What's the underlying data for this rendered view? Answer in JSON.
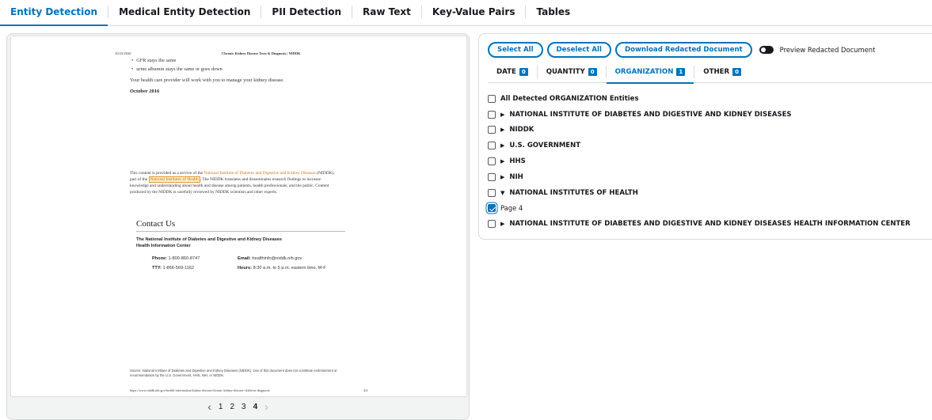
{
  "top_tabs": [
    {
      "label": "Entity Detection"
    },
    {
      "label": "Medical Entity Detection"
    },
    {
      "label": "PII Detection"
    },
    {
      "label": "Raw Text"
    },
    {
      "label": "Key-Value Pairs"
    },
    {
      "label": "Tables"
    }
  ],
  "document": {
    "header_date": "10/23/2020",
    "header_title": "Chronic Kidney Disease Tests & Diagnosis | NIDDK",
    "bullets": [
      "GFR stays the same",
      "urine albumin stays the same or goes down"
    ],
    "manage_line": "Your health care provider will work with you to manage your kidney disease.",
    "date_heading": "October 2016",
    "para1_a": "This content is provided as a service of the ",
    "para1_link": "National Institute of Diabetes and Digestive and Kidney Diseases",
    "para1_b": " (NIDDK),",
    "para2_a": "part of the ",
    "para2_highlight": "National Institutes of Health",
    "para2_b": ". The NIDDK translates and disseminates research findings to increase",
    "para3": "knowledge and understanding about health and disease among patients, health professionals, and the public. Content",
    "para4": "produced by the NIDDK is carefully reviewed by NIDDK scientists and other experts.",
    "contact_title": "Contact Us",
    "contact_org_1": "The National Institute of Diabetes and Digestive and Kidney Diseases",
    "contact_org_2": "Health Information Center",
    "phone_label": "Phone:",
    "phone_value": "1-800-860-8747",
    "tty_label": "TTY:",
    "tty_value": "1-866-569-1162",
    "email_label": "Email:",
    "email_value": "healthinfo@niddk.nih.gov",
    "hours_label": "Hours:",
    "hours_value": "8:30 a.m. to 5 p.m. eastern time, M-F",
    "source_1": "Source: National Institute of Diabetes and Digestive and Kidney Diseases (NIDDK). Use of this document does not constitute endorsement or",
    "source_2": "recommendation by the U.S. Government, HHS, NIH, or NIDDK.",
    "footer_url": "https://www.niddk.nih.gov/health-information/kidney-disease/chronic-kidney-disease-ckd/tests-diagnosis",
    "footer_page": "4/4"
  },
  "pager": {
    "prev": "‹",
    "next": "›",
    "pages": [
      "1",
      "2",
      "3",
      "4"
    ],
    "current": "4"
  },
  "actions": {
    "select_all": "Select All",
    "deselect_all": "Deselect All",
    "download": "Download Redacted Document",
    "preview": "Preview Redacted Document"
  },
  "entity_tabs": [
    {
      "label": "DATE",
      "count": "0"
    },
    {
      "label": "QUANTITY",
      "count": "0"
    },
    {
      "label": "ORGANIZATION",
      "count": "1"
    },
    {
      "label": "OTHER",
      "count": "0"
    }
  ],
  "entities": {
    "all_label": "All Detected ORGANIZATION Entities",
    "items": [
      "NATIONAL INSTITUTE OF DIABETES AND DIGESTIVE AND KIDNEY DISEASES",
      "NIDDK",
      "U.S. GOVERNMENT",
      "HHS",
      "NIH",
      "NATIONAL INSTITUTES OF HEALTH",
      "NATIONAL INSTITUTE OF DIABETES AND DIGESTIVE AND KIDNEY DISEASES HEALTH INFORMATION CENTER"
    ],
    "expanded_page": "Page 4",
    "caret_collapsed": "▶",
    "caret_expanded": "▼"
  },
  "colors": {
    "accent": "#0073bb",
    "highlight_border": "#e8941e",
    "link_orange": "#d4721c"
  }
}
